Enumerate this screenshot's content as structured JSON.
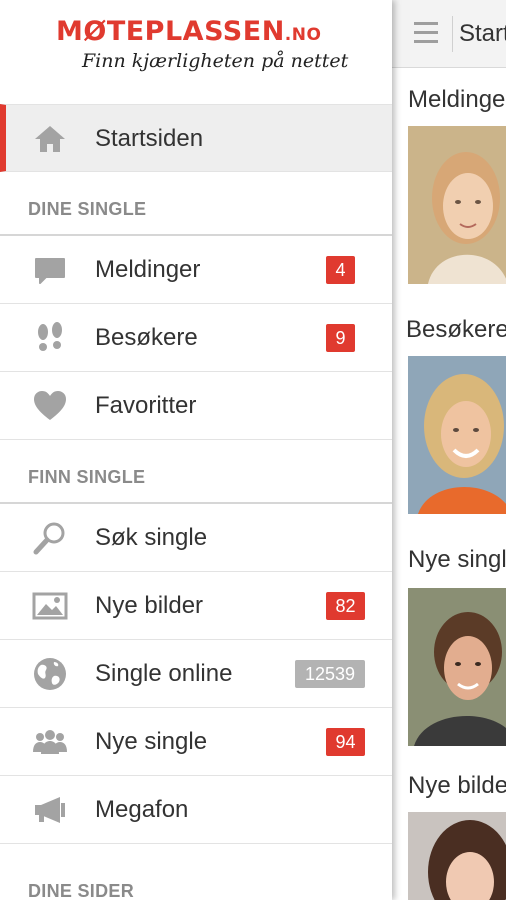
{
  "brand": {
    "logo_main": "MØTEPLASSEN",
    "logo_tld": ".NO",
    "tagline": "Finn kjærligheten på nettet"
  },
  "main": {
    "title": "Startsiden",
    "sections": [
      {
        "title": "Meldinger"
      },
      {
        "title": "Besøkere"
      },
      {
        "title": "Nye single"
      },
      {
        "title": "Nye bilder"
      }
    ]
  },
  "menu": {
    "home": {
      "label": "Startsiden",
      "icon": "home-icon"
    },
    "section_dine_single": "DINE SINGLE",
    "meldinger": {
      "label": "Meldinger",
      "badge": "4",
      "icon": "message-icon"
    },
    "besokere": {
      "label": "Besøkere",
      "badge": "9",
      "icon": "footprints-icon"
    },
    "favoritter": {
      "label": "Favoritter",
      "icon": "heart-icon"
    },
    "section_finn_single": "FINN SINGLE",
    "sok_single": {
      "label": "Søk single",
      "icon": "search-icon"
    },
    "nye_bilder": {
      "label": "Nye bilder",
      "badge": "82",
      "icon": "image-icon"
    },
    "single_online": {
      "label": "Single online",
      "badge": "12539",
      "icon": "globe-icon"
    },
    "nye_single": {
      "label": "Nye single",
      "badge": "94",
      "icon": "people-icon"
    },
    "megafon": {
      "label": "Megafon",
      "icon": "megaphone-icon"
    },
    "section_dine_sider": "DINE SIDER"
  },
  "colors": {
    "accent": "#e03a2f",
    "badge_red": "#e03a2f",
    "badge_grey": "#b3b3b3",
    "icon_grey": "#a3a3a3"
  }
}
